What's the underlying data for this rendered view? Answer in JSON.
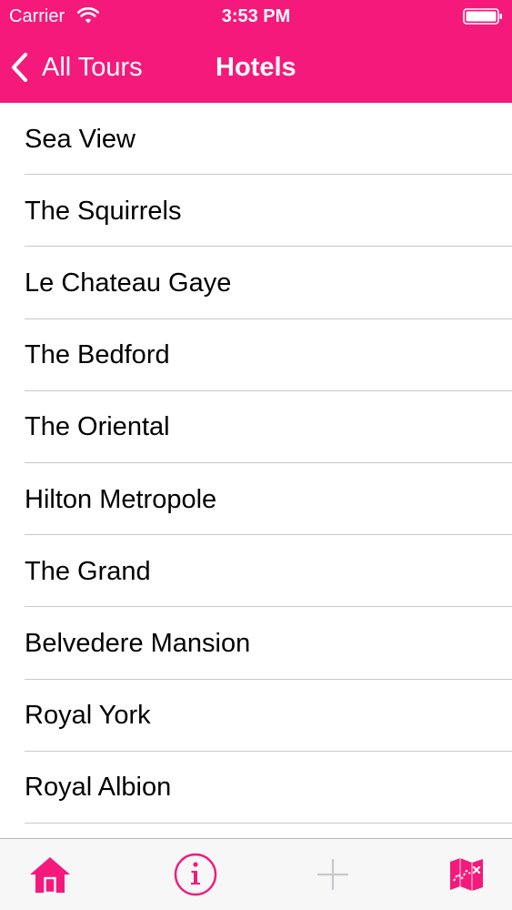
{
  "status_bar": {
    "carrier": "Carrier",
    "time": "3:53 PM",
    "wifi_icon": "wifi-icon",
    "battery_icon": "battery-icon"
  },
  "nav_bar": {
    "back_label": "All Tours",
    "back_icon": "chevron-left-icon",
    "title": "Hotels"
  },
  "hotels": {
    "items": [
      {
        "label": "Sea View"
      },
      {
        "label": "The Squirrels"
      },
      {
        "label": "Le Chateau Gaye"
      },
      {
        "label": "The Bedford"
      },
      {
        "label": "The Oriental"
      },
      {
        "label": "Hilton Metropole"
      },
      {
        "label": "The Grand"
      },
      {
        "label": "Belvedere Mansion"
      },
      {
        "label": "Royal York"
      },
      {
        "label": "Royal Albion"
      }
    ]
  },
  "tab_bar": {
    "tabs": [
      {
        "icon": "home-icon",
        "active": true
      },
      {
        "icon": "info-icon",
        "active": false
      },
      {
        "icon": "plus-icon",
        "active": false
      },
      {
        "icon": "map-icon",
        "active": false
      }
    ]
  },
  "colors": {
    "accent": "#f5197c",
    "tab_bar_background": "#f7f7f8",
    "separator": "#c8c7cc",
    "inactive_icon": "#c7c7cc"
  }
}
